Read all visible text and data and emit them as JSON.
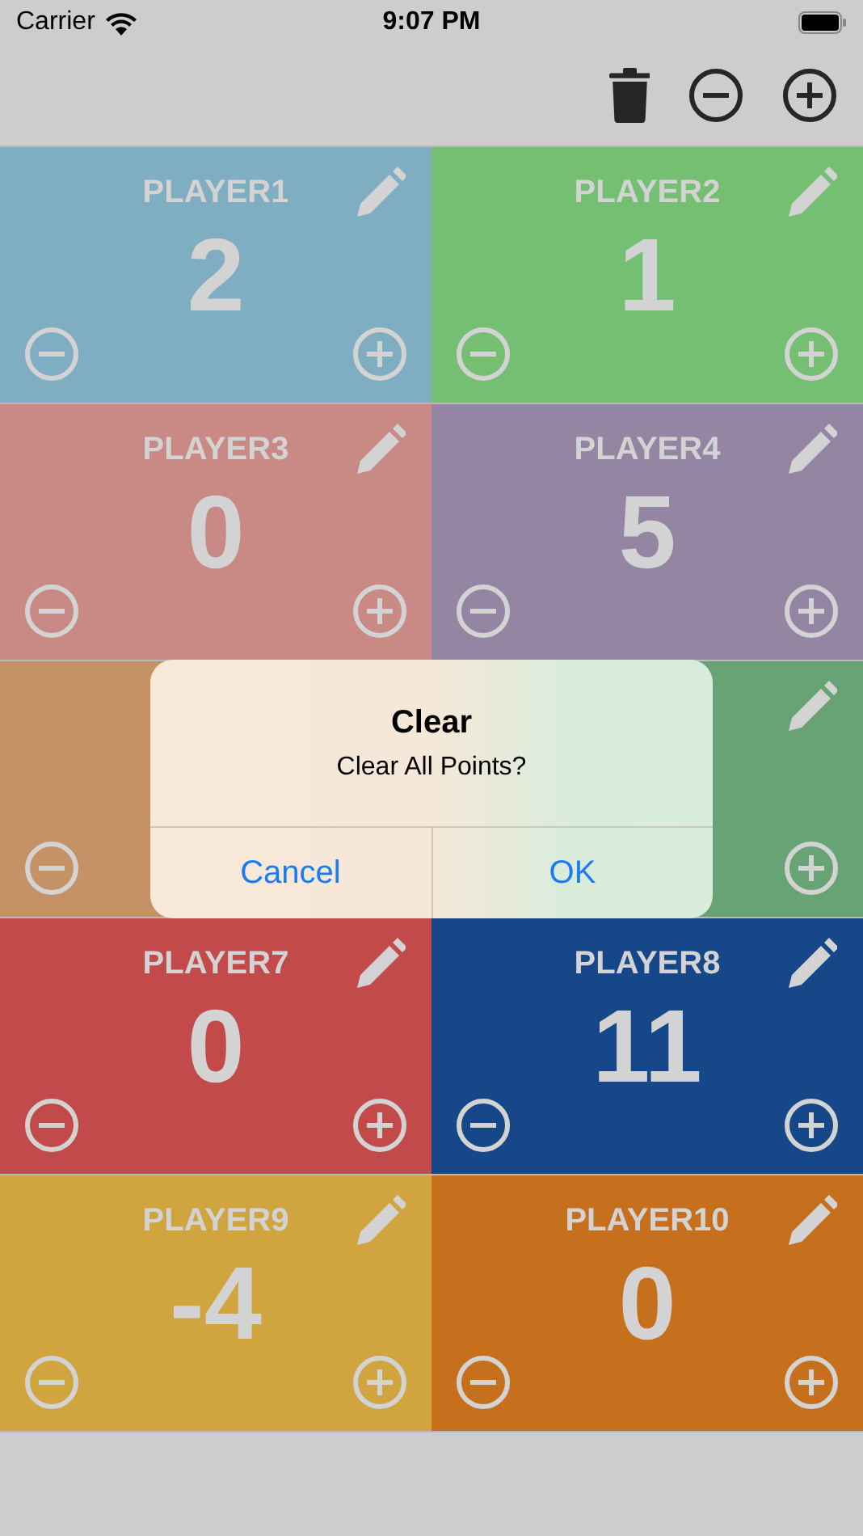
{
  "status_bar": {
    "carrier": "Carrier",
    "time": "9:07 PM"
  },
  "toolbar": {
    "actions": [
      {
        "kind": "trash"
      },
      {
        "kind": "minus"
      },
      {
        "kind": "plus"
      }
    ]
  },
  "players": [
    {
      "name": "PLAYER1",
      "score": "2",
      "color": "#7fadc1"
    },
    {
      "name": "PLAYER2",
      "score": "1",
      "color": "#74bf72"
    },
    {
      "name": "PLAYER3",
      "score": "0",
      "color": "#c98985"
    },
    {
      "name": "PLAYER4",
      "score": "5",
      "color": "#9485a2"
    },
    {
      "color": "#c59265"
    },
    {
      "color": "#67a374"
    },
    {
      "name": "PLAYER7",
      "score": "0",
      "color": "#c24a4a"
    },
    {
      "name": "PLAYER8",
      "score": "11",
      "color": "#164789"
    },
    {
      "name": "PLAYER9",
      "score": "-4",
      "color": "#d0a540"
    },
    {
      "name": "PLAYER10",
      "score": "0",
      "color": "#c66f1d"
    }
  ],
  "alert": {
    "title": "Clear",
    "message": "Clear All Points?",
    "buttons": [
      "Cancel",
      "OK"
    ]
  }
}
